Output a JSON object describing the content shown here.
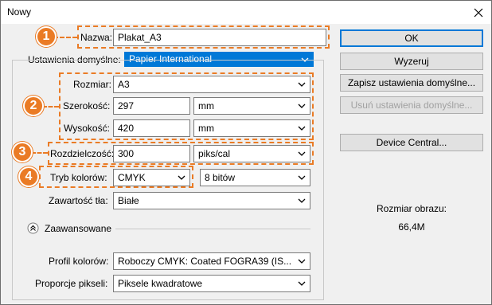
{
  "window": {
    "title": "Nowy"
  },
  "fields": {
    "nazwa_label": "Nazwa:",
    "nazwa_value": "Plakat_A3",
    "preset_label": "Ustawienia domyślne:",
    "preset_value": "Papier International",
    "rozmiar_label": "Rozmiar:",
    "rozmiar_value": "A3",
    "szerokosc_label": "Szerokość:",
    "szerokosc_value": "297",
    "szerokosc_unit": "mm",
    "wysokosc_label": "Wysokość:",
    "wysokosc_value": "420",
    "wysokosc_unit": "mm",
    "rozdzielczosc_label": "Rozdzielczość:",
    "rozdzielczosc_value": "300",
    "rozdzielczosc_unit": "piks/cal",
    "tryb_label": "Tryb kolorów:",
    "tryb_value": "CMYK",
    "bity_value": "8 bitów",
    "zawartosc_label": "Zawartość tła:",
    "zawartosc_value": "Białe",
    "advanced_label": "Zaawansowane",
    "profil_label": "Profil kolorów:",
    "profil_value": "Roboczy CMYK:  Coated FOGRA39 (IS...",
    "proporcje_label": "Proporcje pikseli:",
    "proporcje_value": "Piksele kwadratowe"
  },
  "buttons": {
    "ok": "OK",
    "reset": "Wyzeruj",
    "save_preset": "Zapisz ustawienia domyślne...",
    "delete_preset": "Usuń ustawienia domyślne...",
    "device_central": "Device Central..."
  },
  "info": {
    "size_label": "Rozmiar obrazu:",
    "size_value": "66,4M"
  },
  "badges": [
    "1",
    "2",
    "3",
    "4"
  ],
  "colors": {
    "accent": "#0078d7",
    "annotation": "#ea7b25"
  }
}
